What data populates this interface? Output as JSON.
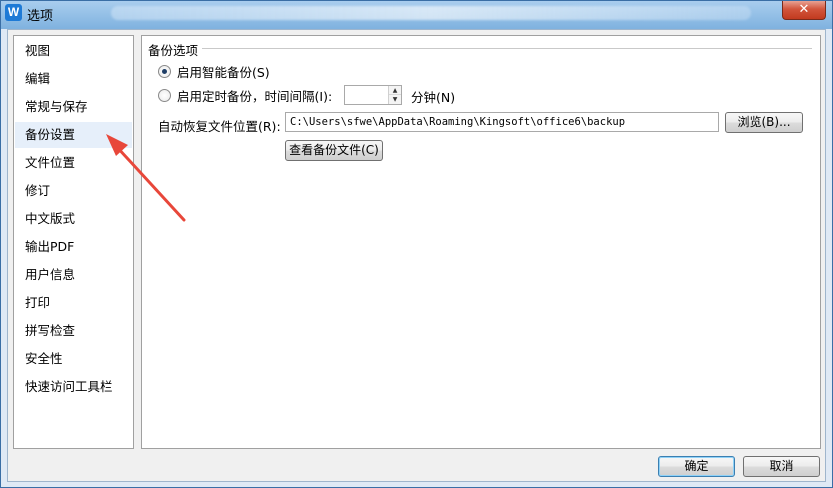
{
  "window": {
    "title": "选项",
    "close_label": "✕",
    "app_icon_glyph": "W"
  },
  "sidebar": {
    "items": [
      {
        "label": "视图"
      },
      {
        "label": "编辑"
      },
      {
        "label": "常规与保存"
      },
      {
        "label": "备份设置"
      },
      {
        "label": "文件位置"
      },
      {
        "label": "修订"
      },
      {
        "label": "中文版式"
      },
      {
        "label": "输出PDF"
      },
      {
        "label": "用户信息"
      },
      {
        "label": "打印"
      },
      {
        "label": "拼写检查"
      },
      {
        "label": "安全性"
      },
      {
        "label": "快速访问工具栏"
      }
    ],
    "selected": "备份设置"
  },
  "backup": {
    "group_title": "备份选项",
    "smart_backup_label": "启用智能备份(S)",
    "smart_backup_checked": true,
    "timed_backup_label": "启用定时备份，时间间隔(I):",
    "timed_backup_checked": false,
    "interval_value": "",
    "minutes_label": "分钟(N)",
    "path_label": "自动恢复文件位置(R):",
    "path_value": "C:\\Users\\sfwe\\AppData\\Roaming\\Kingsoft\\office6\\backup",
    "browse_label": "浏览(B)...",
    "view_backup_label": "查看备份文件(C)"
  },
  "footer": {
    "ok_label": "确定",
    "cancel_label": "取消"
  },
  "colors": {
    "annotation_arrow": "#e8473a",
    "titlebar": "#8fbce6",
    "selected_item": "#e6effa"
  }
}
